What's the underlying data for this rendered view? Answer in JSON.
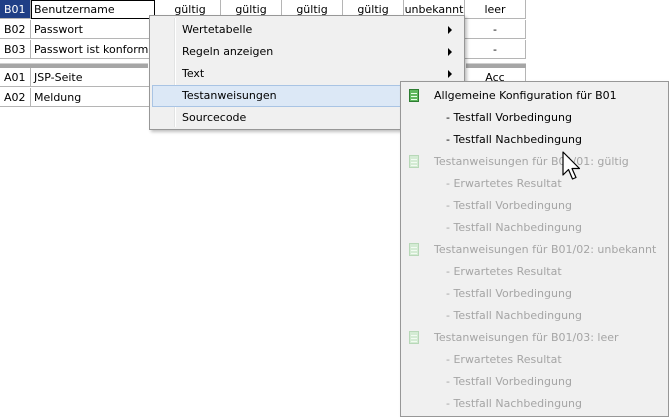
{
  "table": {
    "header_values": [
      "gültig",
      "gültig",
      "gültig",
      "gültig",
      "unbekannt",
      "leer"
    ],
    "rows": [
      {
        "id": "B01",
        "name": "Benutzername",
        "last": "leer"
      },
      {
        "id": "B02",
        "name": "Passwort",
        "last": "-"
      },
      {
        "id": "B03",
        "name": "Passwort ist konform?",
        "last": "-"
      },
      {
        "id": "A01",
        "name": "JSP-Seite",
        "last": "Acc"
      },
      {
        "id": "A02",
        "name": "Meldung",
        "last": ""
      }
    ]
  },
  "context_menu": {
    "items": [
      {
        "label": "Wertetabelle",
        "has_submenu": true
      },
      {
        "label": "Regeln anzeigen",
        "has_submenu": true
      },
      {
        "label": "Text",
        "has_submenu": true
      },
      {
        "label": "Testanweisungen",
        "has_submenu": true,
        "highlighted": true
      },
      {
        "label": "Sourcecode",
        "has_submenu": false
      }
    ]
  },
  "submenu": {
    "items": [
      {
        "label": "Allgemeine Konfiguration für B01",
        "type": "header",
        "enabled": true,
        "icon": "document-icon"
      },
      {
        "label": "- Testfall Vorbedingung",
        "type": "child",
        "enabled": true
      },
      {
        "label": "- Testfall Nachbedingung",
        "type": "child",
        "enabled": true
      },
      {
        "label": "Testanweisungen für B01/01:  gültig",
        "type": "header",
        "enabled": false,
        "icon": "document-icon"
      },
      {
        "label": "- Erwartetes Resultat",
        "type": "child",
        "enabled": false
      },
      {
        "label": "- Testfall Vorbedingung",
        "type": "child",
        "enabled": false
      },
      {
        "label": "- Testfall Nachbedingung",
        "type": "child",
        "enabled": false
      },
      {
        "label": "Testanweisungen für B01/02:  unbekannt",
        "type": "header",
        "enabled": false,
        "icon": "document-icon"
      },
      {
        "label": "- Erwartetes Resultat",
        "type": "child",
        "enabled": false
      },
      {
        "label": "- Testfall Vorbedingung",
        "type": "child",
        "enabled": false
      },
      {
        "label": "- Testfall Nachbedingung",
        "type": "child",
        "enabled": false
      },
      {
        "label": "Testanweisungen für B01/03:  leer",
        "type": "header",
        "enabled": false,
        "icon": "document-icon"
      },
      {
        "label": "- Erwartetes Resultat",
        "type": "child",
        "enabled": false
      },
      {
        "label": "- Testfall Vorbedingung",
        "type": "child",
        "enabled": false
      },
      {
        "label": "- Testfall Nachbedingung",
        "type": "child",
        "enabled": false
      }
    ]
  },
  "colors": {
    "selected_cell": "#1f3f86",
    "menu_background": "#f0f0f0",
    "menu_highlight": "#dce8f6",
    "disabled_text": "#a5a5a5",
    "icon_green": "#5fb85f"
  }
}
